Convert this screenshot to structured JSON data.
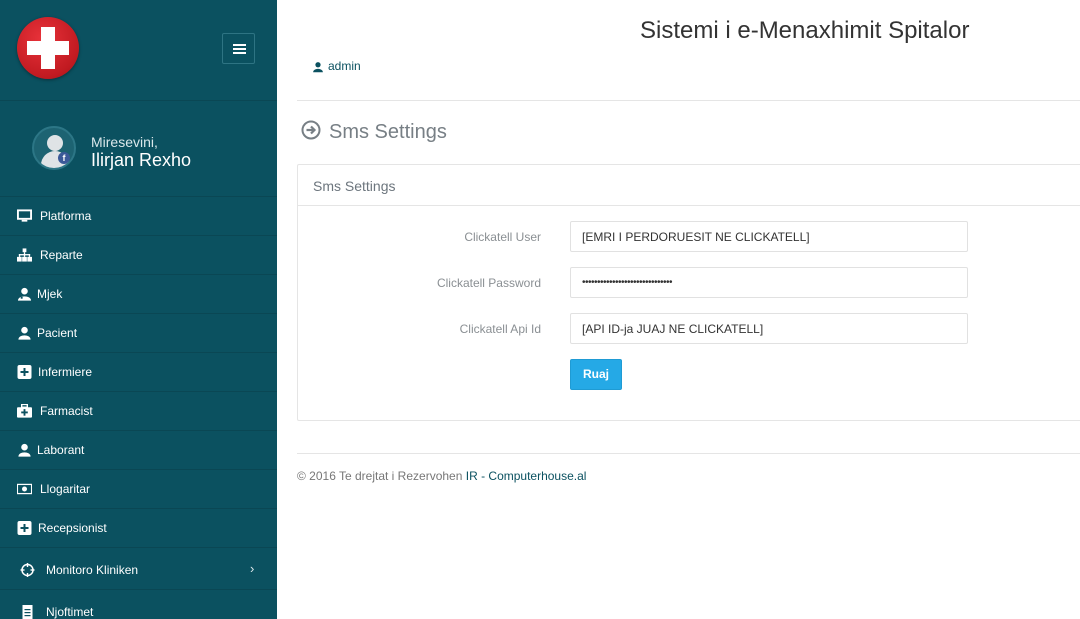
{
  "app": {
    "title": "Sistemi i e-Menaxhimit Spitalor"
  },
  "header": {
    "user_label": "admin"
  },
  "sidebar": {
    "greeting": "Miresevini,",
    "user_name": "Ilirjan Rexho",
    "items": [
      {
        "label": "Platforma",
        "icon": "monitor-icon"
      },
      {
        "label": "Reparte",
        "icon": "sitemap-icon"
      },
      {
        "label": "Mjek",
        "icon": "user-md-icon"
      },
      {
        "label": "Pacient",
        "icon": "user-icon"
      },
      {
        "label": "Infermiere",
        "icon": "plus-square-icon"
      },
      {
        "label": "Farmacist",
        "icon": "medkit-icon"
      },
      {
        "label": "Laborant",
        "icon": "user-icon"
      },
      {
        "label": "Llogaritar",
        "icon": "money-icon"
      },
      {
        "label": "Recepsionist",
        "icon": "plus-square-icon"
      },
      {
        "label": "Monitoro Kliniken",
        "icon": "crosshair-icon"
      },
      {
        "label": "Njoftimet",
        "icon": "file-icon"
      }
    ]
  },
  "page": {
    "title": "Sms Settings"
  },
  "panel": {
    "heading": "Sms Settings",
    "fields": [
      {
        "label": "Clickatell User",
        "value": "[EMRI I PERDORUESIT NE CLICKATELL]"
      },
      {
        "label": "Clickatell Password",
        "value": "••••••••••••••••••••••••••••••"
      },
      {
        "label": "Clickatell Api Id",
        "value": "[API ID-ja JUAJ NE CLICKATELL]"
      }
    ],
    "save_label": "Ruaj"
  },
  "footer": {
    "copyright": "© 2016 Te drejtat i Rezervohen",
    "link": "IR - Computerhouse.al"
  },
  "colors": {
    "sidebar": "#0b5160",
    "accent": "#25a9e6"
  }
}
